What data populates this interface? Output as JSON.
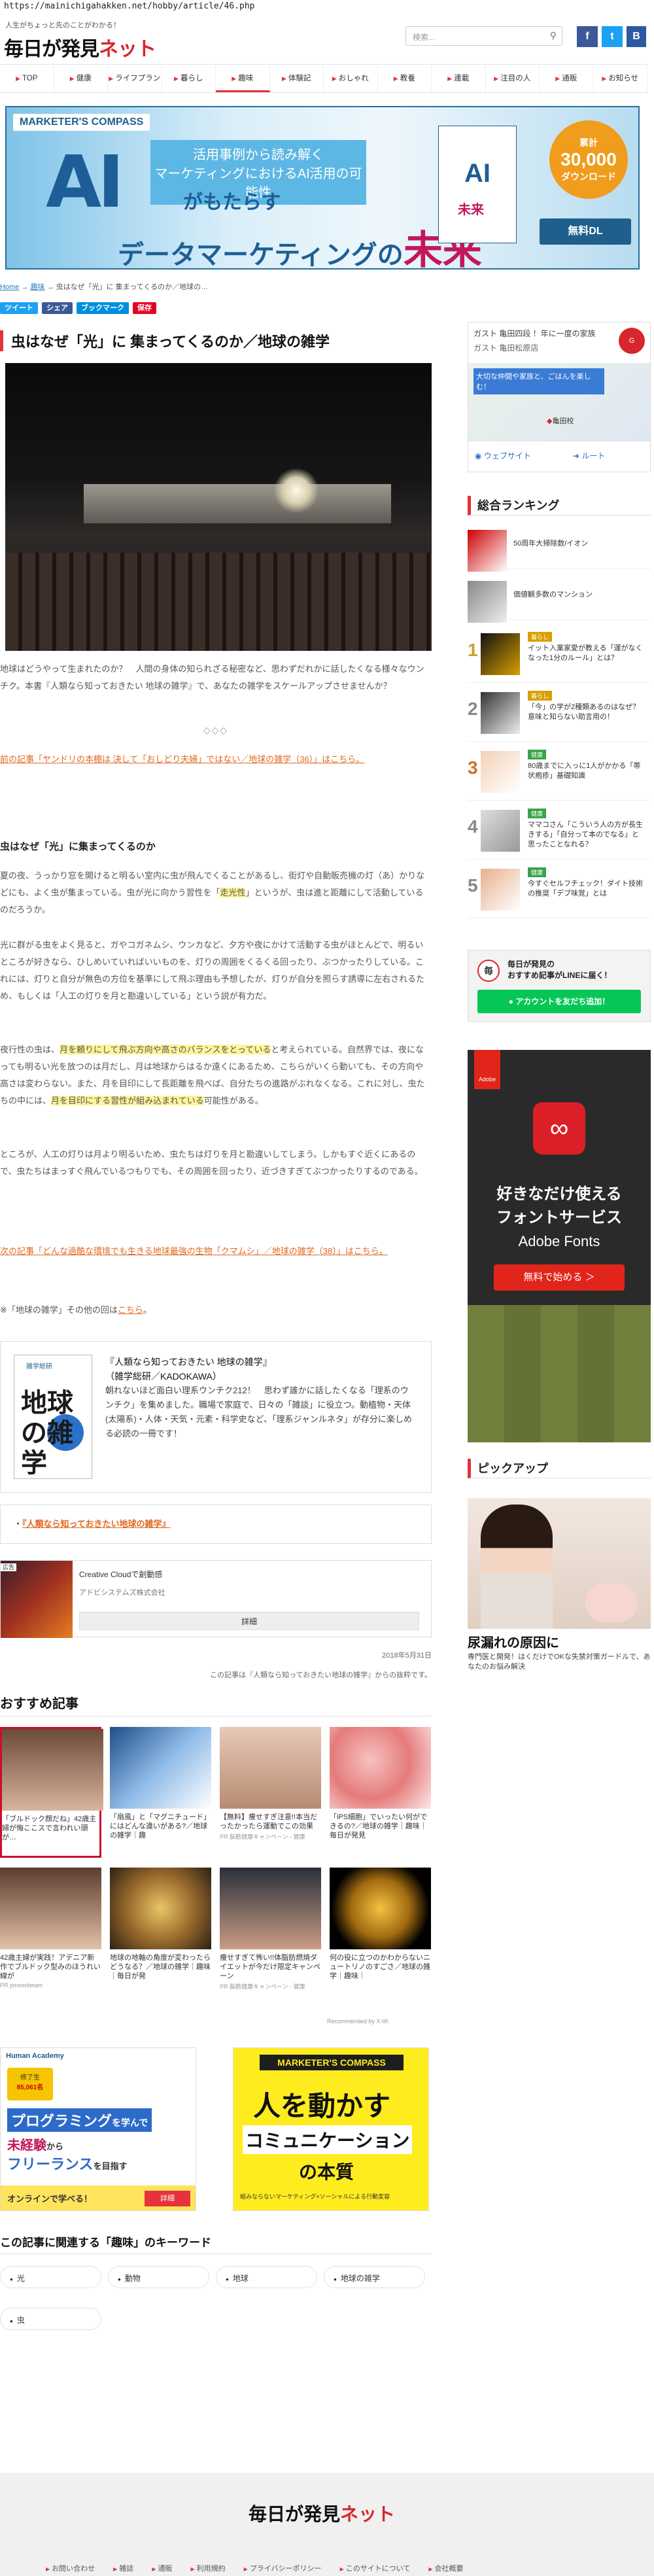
{
  "url": "https://mainichigahakken.net/hobby/article/46.php",
  "site": {
    "tagline": "人生がちょっと先のことがわかる！",
    "logo_main": "毎日が発見",
    "logo_accent": "ネット"
  },
  "search": {
    "placeholder": "検索..."
  },
  "nav": [
    "TOP",
    "健康",
    "ライフプラン",
    "暮らし",
    "趣味",
    "体験記",
    "おしゃれ",
    "教養",
    "連載",
    "注目の人",
    "通販",
    "お知らせ"
  ],
  "banner": {
    "brand": "MARKETER'S COMPASS",
    "ai": "AI",
    "sub1": "活用事例から読み解く",
    "sub2": "マーケティングにおけるAI活用の可能性",
    "line1": "がもたらす",
    "line2": "データマーケティングの",
    "line2_accent": "未来",
    "book": "AI",
    "book_sub": "未来",
    "badge_small": "累計",
    "badge_num": "30,000",
    "badge_unit": "ダウンロード",
    "cta": "無料DL"
  },
  "breadcrumb": {
    "home": "Home",
    "sep1": " → ",
    "cat": "趣味",
    "sep2": " → ",
    "current": "虫はなぜ「光」に 集まってくるのか／地球の…"
  },
  "shares": [
    {
      "label": "ツイート",
      "color": "#1da1f2"
    },
    {
      "label": "シェア",
      "color": "#3b5998"
    },
    {
      "label": "ブックマーク",
      "color": "#008fde"
    },
    {
      "label": "保存",
      "color": "#e60023"
    }
  ],
  "article": {
    "title": "虫はなぜ「光」に 集まってくるのか／地球の雑学",
    "intro": "地球はどうやって生まれたのか？　人間の身体の知られざる秘密など、思わずだれかに話したくなる様々なウンチク。本書『人類なら知っておきたい 地球の雑学』で、あなたの雑学をスケールアップさせませんか？",
    "sep": "◇◇◇",
    "prev_link": "前の記事「ヤンドリの本棚は 決して「おしどり夫婦」ではない／地球の雑学（36）」はこちら。",
    "heading": "虫はなぜ「光」に集まってくるのか",
    "p1a": "夏の夜、うっかり窓を開けると明るい室内に虫が飛んでくることがあるし、街灯や自動販売機の灯（あ）かりなどにも、よく虫が集まっている。虫が光に向かう習性を「",
    "p1b": "走光性",
    "p1c": "」というが、虫は進と距離にして活動しているのだろうか。",
    "p2": "光に群がる虫をよく見ると、ガやコガネムシ、ウンカなど、夕方や夜にかけて活動する虫がほとんどで、明るいところが好きなら、ひしめいていればいいものを、灯りの周囲をくるくる回ったり、ぶつかったりしている。これには、灯りと自分が無色の方位を基準にして飛ぶ理由も予想したが、灯りが自分を照らす誘導に左右されるため、もしくは「人工の灯りを月と勘違いしている」という説が有力だ。",
    "p3a": "夜行性の虫は、",
    "p3b": "月を頼りにして飛ぶ方向や高さのバランスをとっている",
    "p3c": "と考えられている。自然界では、夜になっても明るい光を放つのは月だし、月は地球からはるか遠くにあるため、こちらがいくら動いても、その方向や高さは変わらない。また、月を目印にして長距離を飛べば、自分たちの進路がぶれなくなる。これに対し、虫たちの中には、",
    "p3d": "月を目印にする習性が組み込まれている",
    "p3e": "可能性がある。",
    "p4": "ところが、人工の灯りは月より明るいため、虫たちは灯りを月と勘違いしてしまう。しかもすぐ近くにあるので、虫たちはまっすぐ飛んでいるつもりでも、その周囲を回ったり、近づきすぎてぶつかったりするのである。",
    "next_link": "次の記事「どんな過酷な環境でも生きる地球最強の生物「クマムシ」／地球の雑学（38）」はこちら。",
    "more_a": "※「地球の雑学」その他の回は",
    "more_b": "こちら",
    "more_c": "。",
    "book_title": "『人類なら知っておきたい 地球の雑学』",
    "book_author": "（雑学総研／KADOKAWA）",
    "book_desc": "朝れないほど面白い理系ウンチク212！　思わず誰かに話したくなる「理系のウンチク」を集めました。職場で家庭で、日々の「雑談」に役立つ。動植物・天体(太陽系)・人体・天気・元素・科学史など、「理系ジャンルネタ」が存分に楽しめる必読の一冊です！",
    "book_cover_top": "雑学総研",
    "book_cover_title": "地球の雑学",
    "related_bullet": "・",
    "related": "『人類なら知っておきたい地球の雑学』",
    "ad_label": "広告",
    "ad_title": "Creative Cloudで創動感",
    "ad_sub": "アドビシステムズ株式会社",
    "ad_btn": "詳細",
    "date": "2018年5月31日",
    "note": "この記事は『人類なら知っておきたい地球の雑学』からの抜粋です。"
  },
  "reco_title": "おすすめ記事",
  "reco": [
    {
      "text": "「ブルドック顔だね」42歳主婦が悔ここスで言われい頭が…",
      "sub": ""
    },
    {
      "text": "「扇風」と「マグニチュード」にはどんな違いがある?／地球の雑学｜趣",
      "sub": ""
    },
    {
      "text": "【無料】痩せすぎ注意!!本当だったかったら運動でこの効果",
      "sub": "PR 脳筋健康キャンペーン - 健康"
    },
    {
      "text": "「iPS細胞」でいったい何ができるの?／地球の雑学｜趣味｜毎日が発見",
      "sub": ""
    },
    {
      "text": "42歳主婦が実践！アデニア新作でブルドック型みのほうれい線が",
      "sub": "PR pmoonbeam"
    },
    {
      "text": "地球の地軸の角度が変わったらどうなる？／地球の雑学｜趣味｜毎日が発",
      "sub": ""
    },
    {
      "text": "痩せすぎて怖い!!体脂肪燃焼ダイエットが今だけ限定キャンペーン",
      "sub": "PR 脳筋健康キャンペーン - 健康"
    },
    {
      "text": "何の役に立つのかわからないニュートリノのすごさ／地球の雑学｜趣味｜",
      "sub": ""
    }
  ],
  "reco_footer": "Recommended by  X-lift",
  "ad1": {
    "brand": "Human Academy",
    "count_pre": "修了生",
    "count": "85,061名",
    "l1": "プログラミング",
    "l2": "を学んで",
    "l3": "未経験",
    "l4": "から",
    "l5": "フリーランス",
    "l6": "を目指す",
    "cta": "オンラインで学べる！",
    "btn": "詳細"
  },
  "ad2": {
    "brand": "MARKETER'S COMPASS",
    "l1": "人を動かす",
    "l2": "コミュニケーション",
    "l3": "の本質",
    "foot": "組みならないマーケティング×ソーシャルによる行動変容"
  },
  "kw_title": "この記事に関連する「趣味」のキーワード",
  "keywords": [
    "光",
    "動物",
    "地球",
    "地球の雑学",
    "虫"
  ],
  "footer": {
    "logo_main": "毎日が発見",
    "logo_accent": "ネット",
    "links": [
      "お問い合わせ",
      "雑誌",
      "通販",
      "利用規約",
      "プライバシーポリシー",
      "このサイトについて",
      "会社概要"
    ]
  },
  "side": {
    "map_title": "ガスト 亀田四段 ！年に一度の家族",
    "map_sub": "ガスト 亀田松原店",
    "map_promo": "大切な仲間や家族と、ごはんを楽しむ！",
    "map_place": "亀田校",
    "map_btn1": "ウェブサイト",
    "map_btn2": "ルート",
    "rank_title": "総合ランキング",
    "ranks": [
      {
        "num": "",
        "cat": "",
        "text": "50周年大掃除数/イオン"
      },
      {
        "num": "",
        "cat": "",
        "text": "価値観多数のマンション"
      },
      {
        "num": "1",
        "cat": "暮らし",
        "text": "イット入業家愛が教える「運がなくなった1分のルール」とは？"
      },
      {
        "num": "2",
        "cat": "暮らし",
        "text": "「今」の学が2種類あるのはなぜ？意味と知らない助言用の！"
      },
      {
        "num": "3",
        "cat": "健康",
        "text": "80歳までに入っに1人がかかる「帯状疱疹」基礎知識"
      },
      {
        "num": "4",
        "cat": "健康",
        "text": "ママコさん「こういう人の方が長生きする」「自分って本のでなる」と思ったことなれる？"
      },
      {
        "num": "5",
        "cat": "健康",
        "text": "今すぐセルフチェック！ダイト技術の推奨「デブ味覚」とは"
      }
    ],
    "line_t1": "毎日が発見の",
    "line_t2": "おすすめ記事がLINEに届く！",
    "line_btn": "アカウントを友だち追加！",
    "adobe_t1": "好きなだけ使える",
    "adobe_t2": "フォントサービス",
    "adobe_t3": "Adobe Fonts",
    "adobe_btn": "無料で始める ＞",
    "adobe_logo": "Adobe",
    "pickup_title": "ピックアップ",
    "pickup_text": "尿漏れの原因に",
    "pickup_sub": "専門医と開発！はくだけでOKな失禁対策ガードルで、あなたのお悩み解決"
  }
}
